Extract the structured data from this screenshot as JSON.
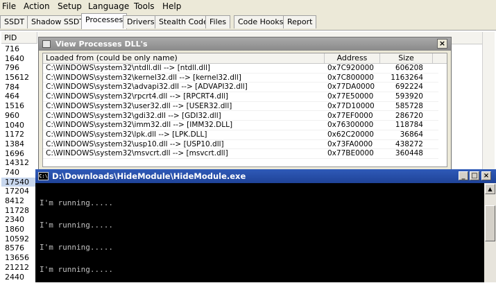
{
  "menu": [
    "File",
    "Action",
    "Setup",
    "Language",
    "Tools",
    "Help"
  ],
  "tabs": [
    "SSDT",
    "Shadow SSDT",
    "Processes",
    "Drivers",
    "Stealth Code",
    "Files",
    "Code Hooks",
    "Report"
  ],
  "active_tab": "Processes",
  "process_table": {
    "pid_header": "PID",
    "pids": [
      "716",
      "1640",
      "796",
      "15612",
      "784",
      "464",
      "1516",
      "960",
      "1040",
      "1172",
      "1384",
      "1696",
      "14312",
      "740",
      "17540",
      "17204",
      "8412",
      "11728",
      "2340",
      "1860",
      "10592",
      "8576",
      "13656",
      "21212",
      "2440"
    ],
    "selected_pid": "17540"
  },
  "dll_dialog": {
    "title": "View Processes DLL's",
    "close_label": "×",
    "columns": [
      "Loaded from (could be only name)",
      "Address",
      "Size"
    ],
    "rows": [
      {
        "path": "C:\\WINDOWS\\system32\\ntdll.dll  -->  [ntdll.dll]",
        "address": "0x7C920000",
        "size": "606208"
      },
      {
        "path": "C:\\WINDOWS\\system32\\kernel32.dll  -->  [kernel32.dll]",
        "address": "0x7C800000",
        "size": "1163264"
      },
      {
        "path": "C:\\WINDOWS\\system32\\advapi32.dll  -->  [ADVAPI32.dll]",
        "address": "0x77DA0000",
        "size": "692224"
      },
      {
        "path": "C:\\WINDOWS\\system32\\rpcrt4.dll  -->  [RPCRT4.dll]",
        "address": "0x77E50000",
        "size": "593920"
      },
      {
        "path": "C:\\WINDOWS\\system32\\user32.dll  -->  [USER32.dll]",
        "address": "0x77D10000",
        "size": "585728"
      },
      {
        "path": "C:\\WINDOWS\\system32\\gdi32.dll  -->  [GDI32.dll]",
        "address": "0x77EF0000",
        "size": "286720"
      },
      {
        "path": "C:\\WINDOWS\\system32\\imm32.dll  -->  [IMM32.DLL]",
        "address": "0x76300000",
        "size": "118784"
      },
      {
        "path": "C:\\WINDOWS\\system32\\lpk.dll  -->  [LPK.DLL]",
        "address": "0x62C20000",
        "size": "36864"
      },
      {
        "path": "C:\\WINDOWS\\system32\\usp10.dll  -->  [USP10.dll]",
        "address": "0x73FA0000",
        "size": "438272"
      },
      {
        "path": "C:\\WINDOWS\\system32\\msvcrt.dll  -->  [msvcrt.dll]",
        "address": "0x77BE0000",
        "size": "360448"
      }
    ]
  },
  "console": {
    "title": "D:\\Downloads\\HideModule\\HideModule.exe",
    "icon_text": "C:\\",
    "lines": [
      "I'm running.....",
      "I'm running.....",
      "I'm running.....",
      "I'm running....."
    ],
    "buttons": {
      "minimize": "_",
      "maximize": "□",
      "close": "×"
    }
  },
  "colors": {
    "console_title": "#1f4398",
    "dialog_title_inactive": "#8a8a8a",
    "selected_row": "#c8d7ee"
  }
}
